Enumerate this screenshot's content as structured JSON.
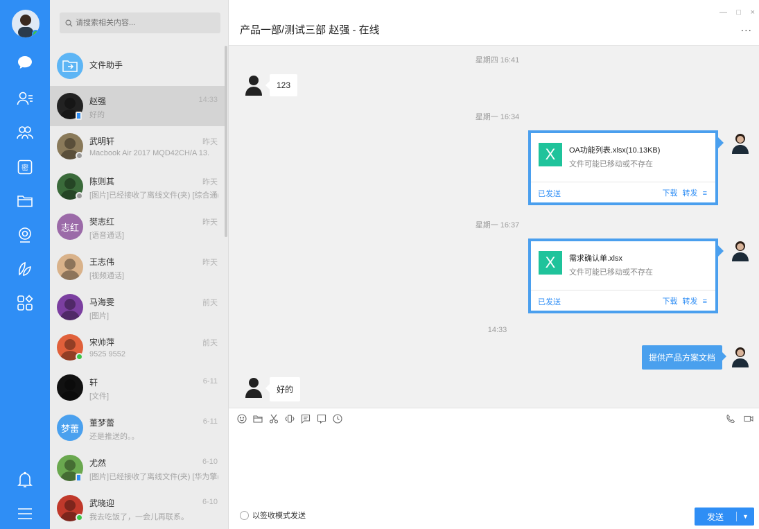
{
  "search": {
    "placeholder": "请搜索相关内容..."
  },
  "contacts": [
    {
      "name": "文件助手",
      "msg": "",
      "time": "",
      "color": "#5db5f5",
      "initials": ""
    },
    {
      "name": "赵强",
      "msg": "好的",
      "time": "14:33",
      "color": "#222222",
      "initials": ""
    },
    {
      "name": "武明轩",
      "msg": "Macbook Air 2017 MQD42CH/A 13.",
      "time": "昨天",
      "color": "#8a7a5a",
      "initials": ""
    },
    {
      "name": "陈则其",
      "msg": "[图片]已经接收了离线文件(夹) [综合通(",
      "time": "昨天",
      "color": "#3a6a3a",
      "initials": ""
    },
    {
      "name": "樊志红",
      "msg": "[语音通话]",
      "time": "昨天",
      "color": "#9b6aa8",
      "initials": "志红"
    },
    {
      "name": "王志伟",
      "msg": "[视频通话]",
      "time": "昨天",
      "color": "#d9b28a",
      "initials": ""
    },
    {
      "name": "马海雯",
      "msg": "[图片]",
      "time": "前天",
      "color": "#7b3fa0",
      "initials": ""
    },
    {
      "name": "宋帅萍",
      "msg": "9525 9552",
      "time": "前天",
      "color": "#e0603a",
      "initials": ""
    },
    {
      "name": "轩",
      "msg": "[文件]",
      "time": "6-11",
      "color": "#111111",
      "initials": ""
    },
    {
      "name": "董梦蕾",
      "msg": "还是推送的。。",
      "time": "6-11",
      "color": "#4aa0ee",
      "initials": "梦蕾"
    },
    {
      "name": "尤然",
      "msg": "[图片]已经接收了离线文件(夹) [华为擎(",
      "time": "6-10",
      "color": "#6aa84f",
      "initials": ""
    },
    {
      "name": "武晓迎",
      "msg": "我去吃饭了，一会儿再联系。",
      "time": "6-10",
      "color": "#c0392b",
      "initials": ""
    }
  ],
  "chat": {
    "title": "产品一部/测试三部 赵强 - 在线",
    "more": "...",
    "win_min": "—",
    "win_max": "□",
    "win_close": "×",
    "times": [
      "星期四 16:41",
      "星期一 16:34",
      "星期一 16:37",
      "14:33"
    ],
    "msg1": "123",
    "file1": {
      "name": "OA功能列表.xlsx(10.13KB)",
      "status": "文件可能已移动或不存在",
      "icon": "X",
      "sent": "已发送",
      "download": "下载",
      "forward": "转发"
    },
    "file2": {
      "name": "需求确认单.xlsx",
      "status": "文件可能已移动或不存在",
      "icon": "X",
      "sent": "已发送",
      "download": "下载",
      "forward": "转发"
    },
    "msg_out": "提供产品方案文档",
    "msg_last": "好的"
  },
  "composer": {
    "sign_label": "以签收模式发送",
    "send_label": "发送",
    "send_dropdown": "▼"
  },
  "colors": {
    "rail": "#2f8ef5",
    "accent": "#4a9fee",
    "excel": "#1fc39b"
  }
}
